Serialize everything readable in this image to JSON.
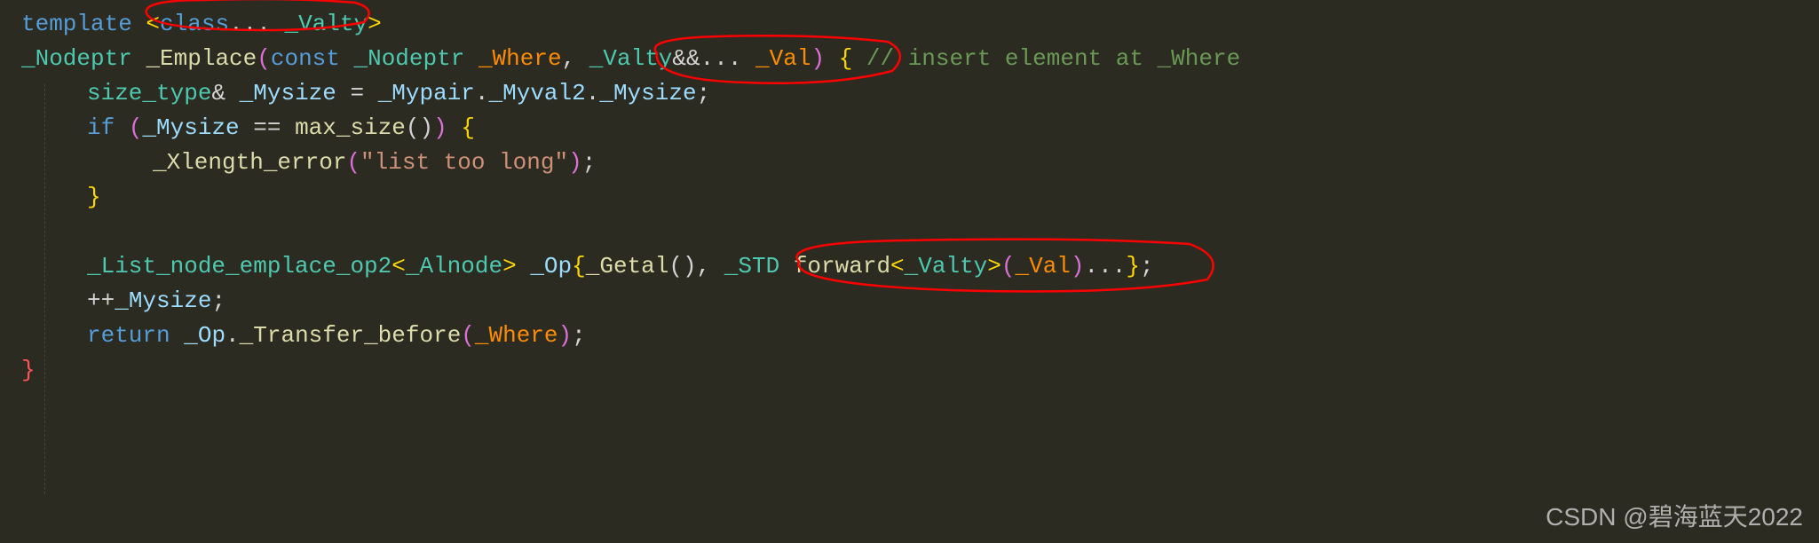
{
  "code": {
    "l1": {
      "template_kw": "template",
      "angle_open": " <",
      "class_kw": "class",
      "ellipsis": "...",
      "valty": " _Valty",
      "angle_close": ">"
    },
    "l2": {
      "nodeptr": "_Nodeptr ",
      "emplace": "_Emplace",
      "paren_open": "(",
      "const_kw": "const",
      "space1": " ",
      "nodeptr2": "_Nodeptr",
      "space2": " ",
      "where": "_Where",
      "comma1": ", ",
      "valty": "_Valty",
      "ampamp": "&&",
      "ellipsis": "...",
      "space3": " ",
      "val": "_Val",
      "paren_close": ")",
      "space4": " ",
      "brace_open": "{",
      "comment": " // insert element at _Where"
    },
    "l3": {
      "size_type": "size_type",
      "amp": "&",
      "space1": " ",
      "mysize": "_Mysize",
      "eq": " = ",
      "mypair": "_Mypair",
      "dot1": ".",
      "myval2": "_Myval2",
      "dot2": ".",
      "mysize2": "_Mysize",
      "semi": ";"
    },
    "l4": {
      "if_kw": "if",
      "paren_open": " (",
      "mysize": "_Mysize",
      "eqeq": " == ",
      "maxsize": "max_size",
      "parens": "()",
      "paren_close": ")",
      "brace_open": " {"
    },
    "l5": {
      "xlength": "_Xlength_error",
      "paren_open": "(",
      "str": "\"list too long\"",
      "paren_close": ")",
      "semi": ";"
    },
    "l6": {
      "brace_close": "}"
    },
    "l8": {
      "listnode": "_List_node_emplace_op2",
      "angle_open": "<",
      "alnode": "_Alnode",
      "angle_close": ">",
      "space1": " ",
      "op": "_Op",
      "brace_open": "{",
      "getal": "_Getal",
      "parens": "()",
      "comma": ", ",
      "std": "_STD",
      "space2": " ",
      "forward": "forward",
      "angle_open2": "<",
      "valty": "_Valty",
      "angle_close2": ">",
      "paren_open": "(",
      "val": "_Val",
      "paren_close": ")",
      "ellipsis": "...",
      "brace_close": "}",
      "semi": ";"
    },
    "l9": {
      "plusplus": "++",
      "mysize": "_Mysize",
      "semi": ";"
    },
    "l10": {
      "return_kw": "return",
      "space1": " ",
      "op": "_Op",
      "dot": ".",
      "transfer": "_Transfer_before",
      "paren_open": "(",
      "where": "_Where",
      "paren_close": ")",
      "semi": ";"
    },
    "l11": {
      "brace_close": "}"
    }
  },
  "watermark": "CSDN @碧海蓝天2022",
  "annotations": {
    "circle1": {
      "stroke": "#ff0000"
    },
    "circle2": {
      "stroke": "#ff0000"
    },
    "circle3": {
      "stroke": "#ff0000"
    }
  }
}
